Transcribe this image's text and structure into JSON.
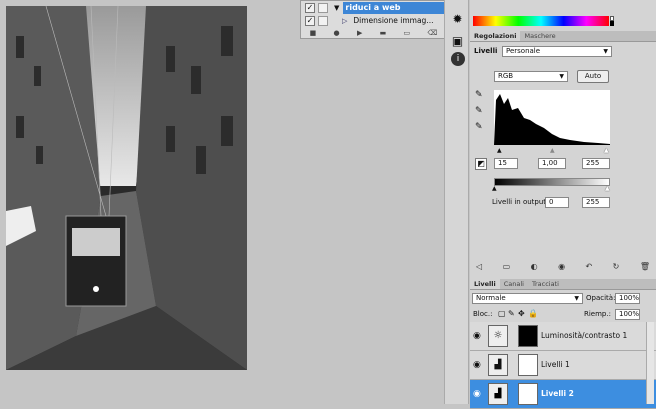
{
  "actions": {
    "rows": [
      {
        "label": "riduci a web",
        "selected": true
      },
      {
        "label": "Dimensione immag...",
        "selected": false
      }
    ],
    "tools": [
      "■",
      "●",
      "▶",
      "▬",
      "▭",
      "⌫"
    ]
  },
  "dock": {
    "icons": [
      "burst-icon",
      "image-icon",
      "info-icon"
    ]
  },
  "color_tabs": {
    "tabs": [
      "Regolazioni",
      "Maschere"
    ]
  },
  "adjust": {
    "title": "Livelli",
    "preset": "Personale",
    "channel": "RGB",
    "auto_label": "Auto",
    "input_black": "15",
    "input_gamma": "1,00",
    "input_white": "255",
    "output_label": "Livelli in output:",
    "output_black": "0",
    "output_white": "255"
  },
  "layers_tabs": {
    "tabs": [
      "Livelli",
      "Canali",
      "Tracciati"
    ]
  },
  "layers_panel": {
    "blend_mode": "Normale",
    "opacity_label": "Opacità:",
    "opacity_value": "100%",
    "lock_label": "Bloc.:",
    "fill_label": "Riemp.:",
    "fill_value": "100%",
    "layers": [
      {
        "name": "Luminosità/contrasto 1",
        "selected": false
      },
      {
        "name": "Livelli 1",
        "selected": false
      },
      {
        "name": "Livelli 2",
        "selected": true
      }
    ]
  },
  "colors": {
    "selection": "#3d8ee0",
    "panel": "#d4d4d4",
    "workspace": "#c5c5c5"
  }
}
